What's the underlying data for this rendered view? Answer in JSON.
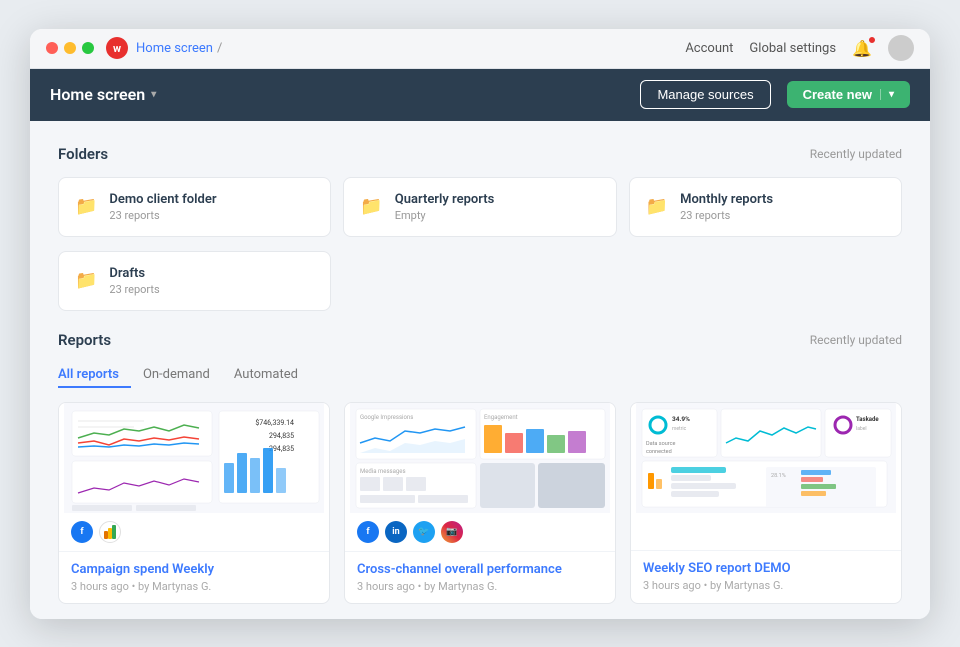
{
  "browser": {
    "breadcrumb_home": "Home screen",
    "breadcrumb_sep": "/",
    "nav_account": "Account",
    "nav_global_settings": "Global settings",
    "logo_letter": "w"
  },
  "header": {
    "title": "Home screen",
    "manage_sources_label": "Manage sources",
    "create_new_label": "Create new"
  },
  "folders_section": {
    "title": "Folders",
    "recently_updated": "Recently updated",
    "folders": [
      {
        "name": "Demo client folder",
        "count": "23 reports"
      },
      {
        "name": "Quarterly reports",
        "count": "Empty"
      },
      {
        "name": "Monthly reports",
        "count": "23 reports"
      },
      {
        "name": "Drafts",
        "count": "23 reports"
      }
    ]
  },
  "reports_section": {
    "title": "Reports",
    "recently_updated": "Recently updated",
    "tabs": [
      {
        "label": "All reports",
        "active": true
      },
      {
        "label": "On-demand",
        "active": false
      },
      {
        "label": "Automated",
        "active": false
      }
    ],
    "reports": [
      {
        "title": "Campaign spend Weekly",
        "meta": "3 hours ago • by Martynas G.",
        "channels": [
          "fb",
          "ga"
        ]
      },
      {
        "title": "Cross-channel overall performance",
        "meta": "3 hours ago • by Martynas G.",
        "channels": [
          "fb",
          "li",
          "tw",
          "ig"
        ]
      },
      {
        "title": "Weekly SEO report DEMO",
        "meta": "3 hours ago • by Martynas G.",
        "channels": []
      }
    ]
  }
}
